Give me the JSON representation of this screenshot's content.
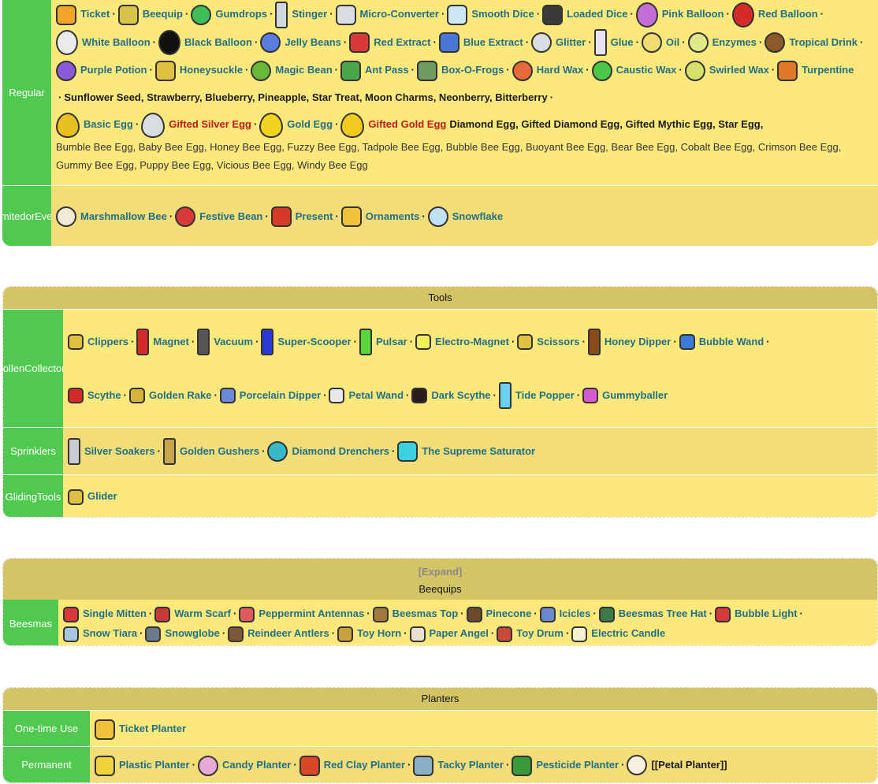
{
  "materials": {
    "regular": {
      "label": "Regular",
      "items": [
        {
          "name": "Ticket",
          "icon": "ticket-icon",
          "color": "#f3a52a",
          "shape": "sq"
        },
        {
          "name": "Beequip",
          "icon": "beequip-icon",
          "color": "#d8c44a",
          "shape": "sq"
        },
        {
          "name": "Gumdrops",
          "icon": "gumdrops-icon",
          "color": "#3fbf5a",
          "shape": "ci"
        },
        {
          "name": "Stinger",
          "icon": "stinger-icon",
          "color": "#cfd6dc",
          "shape": "tl"
        },
        {
          "name": "Micro-Converter",
          "icon": "micro-converter-icon",
          "color": "#d9dde0",
          "shape": "sq"
        },
        {
          "name": "Smooth Dice",
          "icon": "smooth-dice-icon",
          "color": "#cfe8f5",
          "shape": "sq"
        },
        {
          "name": "Loaded Dice",
          "icon": "loaded-dice-icon",
          "color": "#3a3a3a",
          "shape": "sq"
        },
        {
          "name": "Pink Balloon",
          "icon": "pink-balloon-icon",
          "color": "#c46fd8",
          "shape": "bl"
        },
        {
          "name": "Red Balloon",
          "icon": "red-balloon-icon",
          "color": "#d62a2a",
          "shape": "bl"
        },
        {
          "name": "White Balloon",
          "icon": "white-balloon-icon",
          "color": "#e8eaec",
          "shape": "bl"
        },
        {
          "name": "Black Balloon",
          "icon": "black-balloon-icon",
          "color": "#111111",
          "shape": "bl"
        },
        {
          "name": "Jelly Beans",
          "icon": "jelly-beans-icon",
          "color": "#5a7de0",
          "shape": "ci"
        },
        {
          "name": "Red Extract",
          "icon": "red-extract-icon",
          "color": "#d83a3a",
          "shape": "sq"
        },
        {
          "name": "Blue Extract",
          "icon": "blue-extract-icon",
          "color": "#4a78d6",
          "shape": "sq"
        },
        {
          "name": "Glitter",
          "icon": "glitter-icon",
          "color": "#d8dde0",
          "shape": "ci"
        },
        {
          "name": "Glue",
          "icon": "glue-icon",
          "color": "#e9e2f5",
          "shape": "tl"
        },
        {
          "name": "Oil",
          "icon": "oil-icon",
          "color": "#f1dc70",
          "shape": "ci"
        },
        {
          "name": "Enzymes",
          "icon": "enzymes-icon",
          "color": "#dfe98a",
          "shape": "ci"
        },
        {
          "name": "Tropical Drink",
          "icon": "tropical-drink-icon",
          "color": "#8a5a2a",
          "shape": "ci"
        },
        {
          "name": "Purple Potion",
          "icon": "purple-potion-icon",
          "color": "#8a5ad6",
          "shape": "ci"
        },
        {
          "name": "Honeysuckle",
          "icon": "honeysuckle-icon",
          "color": "#e0c040",
          "shape": "sq"
        },
        {
          "name": "Magic Bean",
          "icon": "magic-bean-icon",
          "color": "#6ab83a",
          "shape": "ci"
        },
        {
          "name": "Ant Pass",
          "icon": "ant-pass-icon",
          "color": "#4aa84a",
          "shape": "sq"
        },
        {
          "name": "Box-O-Frogs",
          "icon": "box-o-frogs-icon",
          "color": "#6f9a60",
          "shape": "sq"
        },
        {
          "name": "Hard Wax",
          "icon": "hard-wax-icon",
          "color": "#e86a3a",
          "shape": "ci"
        },
        {
          "name": "Caustic Wax",
          "icon": "caustic-wax-icon",
          "color": "#4ac84a",
          "shape": "ci"
        },
        {
          "name": "Swirled Wax",
          "icon": "swirled-wax-icon",
          "color": "#d6e06a",
          "shape": "ci"
        },
        {
          "name": "Turpentine",
          "icon": "turpentine-icon",
          "color": "#e07a2a",
          "shape": "sq"
        }
      ],
      "plain_text": "Sunflower Seed, Strawberry, Blueberry, Pineapple, Star Treat, Moon Charms, Neonberry, Bitterberry",
      "eggs": [
        {
          "name": "Basic Egg",
          "icon": "basic-egg-icon",
          "color": "#e8c020",
          "shape": "eg",
          "style": "blue"
        },
        {
          "name": "Gifted Silver Egg",
          "icon": "gifted-silver-egg-icon",
          "color": "#d8dde0",
          "shape": "eg",
          "style": "red"
        },
        {
          "name": "Gold Egg",
          "icon": "gold-egg-icon",
          "color": "#f3d21e",
          "shape": "eg",
          "style": "blue"
        },
        {
          "name": "Gifted Gold Egg",
          "icon": "gifted-gold-egg-icon",
          "color": "#f0cb1e",
          "shape": "eg",
          "style": "red"
        }
      ],
      "egg_plain": "Diamond Egg, Gifted Diamond Egg, Gifted Mythic Egg, Star Egg,",
      "egg_plain2": "Bumble Bee Egg, Baby Bee Egg, Honey Bee Egg, Fuzzy Bee Egg, Tadpole Bee Egg, Bubble Bee Egg, Buoyant Bee Egg, Bear Bee Egg, Cobalt Bee Egg, Crimson Bee Egg,",
      "egg_plain3": "Gummy Bee Egg, Puppy Bee Egg, Vicious Bee Egg, Windy Bee Egg"
    },
    "limited": {
      "label": "Limited or Event",
      "label_lines": [
        "Limited",
        "or",
        "Event"
      ],
      "items": [
        {
          "name": "Marshmallow Bee",
          "icon": "marshmallow-bee-icon",
          "color": "#f3ead6",
          "shape": "ci"
        },
        {
          "name": "Festive Bean",
          "icon": "festive-bean-icon",
          "color": "#d83a3a",
          "shape": "ci"
        },
        {
          "name": "Present",
          "icon": "present-icon",
          "color": "#d83a2a",
          "shape": "sq"
        },
        {
          "name": "Ornaments",
          "icon": "ornaments-icon",
          "color": "#f0c23a",
          "shape": "sq"
        },
        {
          "name": "Snowflake",
          "icon": "snowflake-icon",
          "color": "#bfe2f5",
          "shape": "ci"
        }
      ]
    }
  },
  "tools": {
    "header": "Tools",
    "groups": [
      {
        "label": "Pollen Collectors",
        "label_lines": [
          "Pollen",
          "Collectors"
        ],
        "rows": [
          [
            {
              "name": "Clippers",
              "icon": "clippers-icon",
              "color": "#e0c040",
              "shape": "sm"
            },
            {
              "name": "Magnet",
              "icon": "magnet-icon",
              "color": "#d62a2a",
              "shape": "tl"
            },
            {
              "name": "Vacuum",
              "icon": "vacuum-icon",
              "color": "#555555",
              "shape": "tl"
            },
            {
              "name": "Super-Scooper",
              "icon": "super-scooper-icon",
              "color": "#2a3ad6",
              "shape": "tl"
            },
            {
              "name": "Pulsar",
              "icon": "pulsar-icon",
              "color": "#5ad63a",
              "shape": "tl"
            },
            {
              "name": "Electro-Magnet",
              "icon": "electro-magnet-icon",
              "color": "#f0f05a",
              "shape": "sm"
            },
            {
              "name": "Scissors",
              "icon": "scissors-icon",
              "color": "#e0c040",
              "shape": "sm"
            },
            {
              "name": "Honey Dipper",
              "icon": "honey-dipper-icon",
              "color": "#8a4a1a",
              "shape": "tl"
            },
            {
              "name": "Bubble Wand",
              "icon": "bubble-wand-icon",
              "color": "#3a7ad6",
              "shape": "sm"
            }
          ],
          [
            {
              "name": "Scythe",
              "icon": "scythe-icon",
              "color": "#d62a2a",
              "shape": "sm"
            },
            {
              "name": "Golden Rake",
              "icon": "golden-rake-icon",
              "color": "#d6b43a",
              "shape": "sm"
            },
            {
              "name": "Porcelain Dipper",
              "icon": "porcelain-dipper-icon",
              "color": "#6a8ad6",
              "shape": "sm"
            },
            {
              "name": "Petal Wand",
              "icon": "petal-wand-icon",
              "color": "#e8e8e8",
              "shape": "sm"
            },
            {
              "name": "Dark Scythe",
              "icon": "dark-scythe-icon",
              "color": "#2a1a1a",
              "shape": "sm"
            },
            {
              "name": "Tide Popper",
              "icon": "tide-popper-icon",
              "color": "#6ad0f0",
              "shape": "tl"
            },
            {
              "name": "Gummyballer",
              "icon": "gummyballer-icon",
              "color": "#d65ad0",
              "shape": "sm"
            }
          ]
        ]
      },
      {
        "label": "Sprinklers",
        "label_lines": [
          "Sprinklers"
        ],
        "rows": [
          [
            {
              "name": "Silver Soakers",
              "icon": "silver-soakers-icon",
              "color": "#c8ced4",
              "shape": "tl"
            },
            {
              "name": "Golden Gushers",
              "icon": "golden-gushers-icon",
              "color": "#c8a44a",
              "shape": "tl"
            },
            {
              "name": "Diamond Drenchers",
              "icon": "diamond-drenchers-icon",
              "color": "#3ab8c8",
              "shape": "ci"
            },
            {
              "name": "The Supreme Saturator",
              "icon": "supreme-saturator-icon",
              "color": "#3ad0e0",
              "shape": "sq"
            }
          ]
        ]
      },
      {
        "label": "Gliding Tools",
        "label_lines": [
          "Gliding",
          "Tools"
        ],
        "rows": [
          [
            {
              "name": "Glider",
              "icon": "glider-icon",
              "color": "#e0c040",
              "shape": "sm"
            }
          ]
        ]
      }
    ]
  },
  "beequips": {
    "expand": "[Expand]",
    "header": "Beequips",
    "group_label": "Beesmas",
    "rows": [
      [
        {
          "name": "Single Mitten",
          "icon": "single-mitten-icon",
          "color": "#d83a3a"
        },
        {
          "name": "Warm Scarf",
          "icon": "warm-scarf-icon",
          "color": "#c83a3a"
        },
        {
          "name": "Peppermint Antennas",
          "icon": "peppermint-antennas-icon",
          "color": "#e05a5a"
        },
        {
          "name": "Beesmas Top",
          "icon": "beesmas-top-icon",
          "color": "#a07a3a"
        },
        {
          "name": "Pinecone",
          "icon": "pinecone-icon",
          "color": "#6a4a2a"
        },
        {
          "name": "Icicles",
          "icon": "icicles-icon",
          "color": "#6a8ad0"
        },
        {
          "name": "Beesmas Tree Hat",
          "icon": "beesmas-tree-hat-icon",
          "color": "#3a7a4a"
        },
        {
          "name": "Bubble Light",
          "icon": "bubble-light-icon",
          "color": "#d63a3a"
        }
      ],
      [
        {
          "name": "Snow Tiara",
          "icon": "snow-tiara-icon",
          "color": "#a8c8e0"
        },
        {
          "name": "Snowglobe",
          "icon": "snowglobe-icon",
          "color": "#6a7a8a"
        },
        {
          "name": "Reindeer Antlers",
          "icon": "reindeer-antlers-icon",
          "color": "#7a5a3a"
        },
        {
          "name": "Toy Horn",
          "icon": "toy-horn-icon",
          "color": "#c8a040"
        },
        {
          "name": "Paper Angel",
          "icon": "paper-angel-icon",
          "color": "#e8e0d0"
        },
        {
          "name": "Toy Drum",
          "icon": "toy-drum-icon",
          "color": "#c84a3a"
        },
        {
          "name": "Electric Candle",
          "icon": "electric-candle-icon",
          "color": "#f5f0d0"
        }
      ]
    ]
  },
  "planters": {
    "header": "Planters",
    "groups": [
      {
        "label": "One-time Use",
        "items": [
          {
            "name": "Ticket Planter",
            "icon": "ticket-planter-icon",
            "color": "#f0c23a",
            "shape": "sq"
          }
        ]
      },
      {
        "label": "Permanent",
        "items": [
          {
            "name": "Plastic Planter",
            "icon": "plastic-planter-icon",
            "color": "#f0d23a",
            "shape": "sq"
          },
          {
            "name": "Candy Planter",
            "icon": "candy-planter-icon",
            "color": "#e8a8d8",
            "shape": "ci"
          },
          {
            "name": "Red Clay Planter",
            "icon": "red-clay-planter-icon",
            "color": "#d8482a",
            "shape": "sq"
          },
          {
            "name": "Tacky Planter",
            "icon": "tacky-planter-icon",
            "color": "#8ab0c8",
            "shape": "sq"
          },
          {
            "name": "Pesticide Planter",
            "icon": "pesticide-planter-icon",
            "color": "#3a9a3a",
            "shape": "sq"
          }
        ],
        "plain": "[[Petal Planter]]",
        "plain_icon": {
          "icon": "petal-planter-icon",
          "color": "#f5f0e0"
        }
      }
    ]
  }
}
